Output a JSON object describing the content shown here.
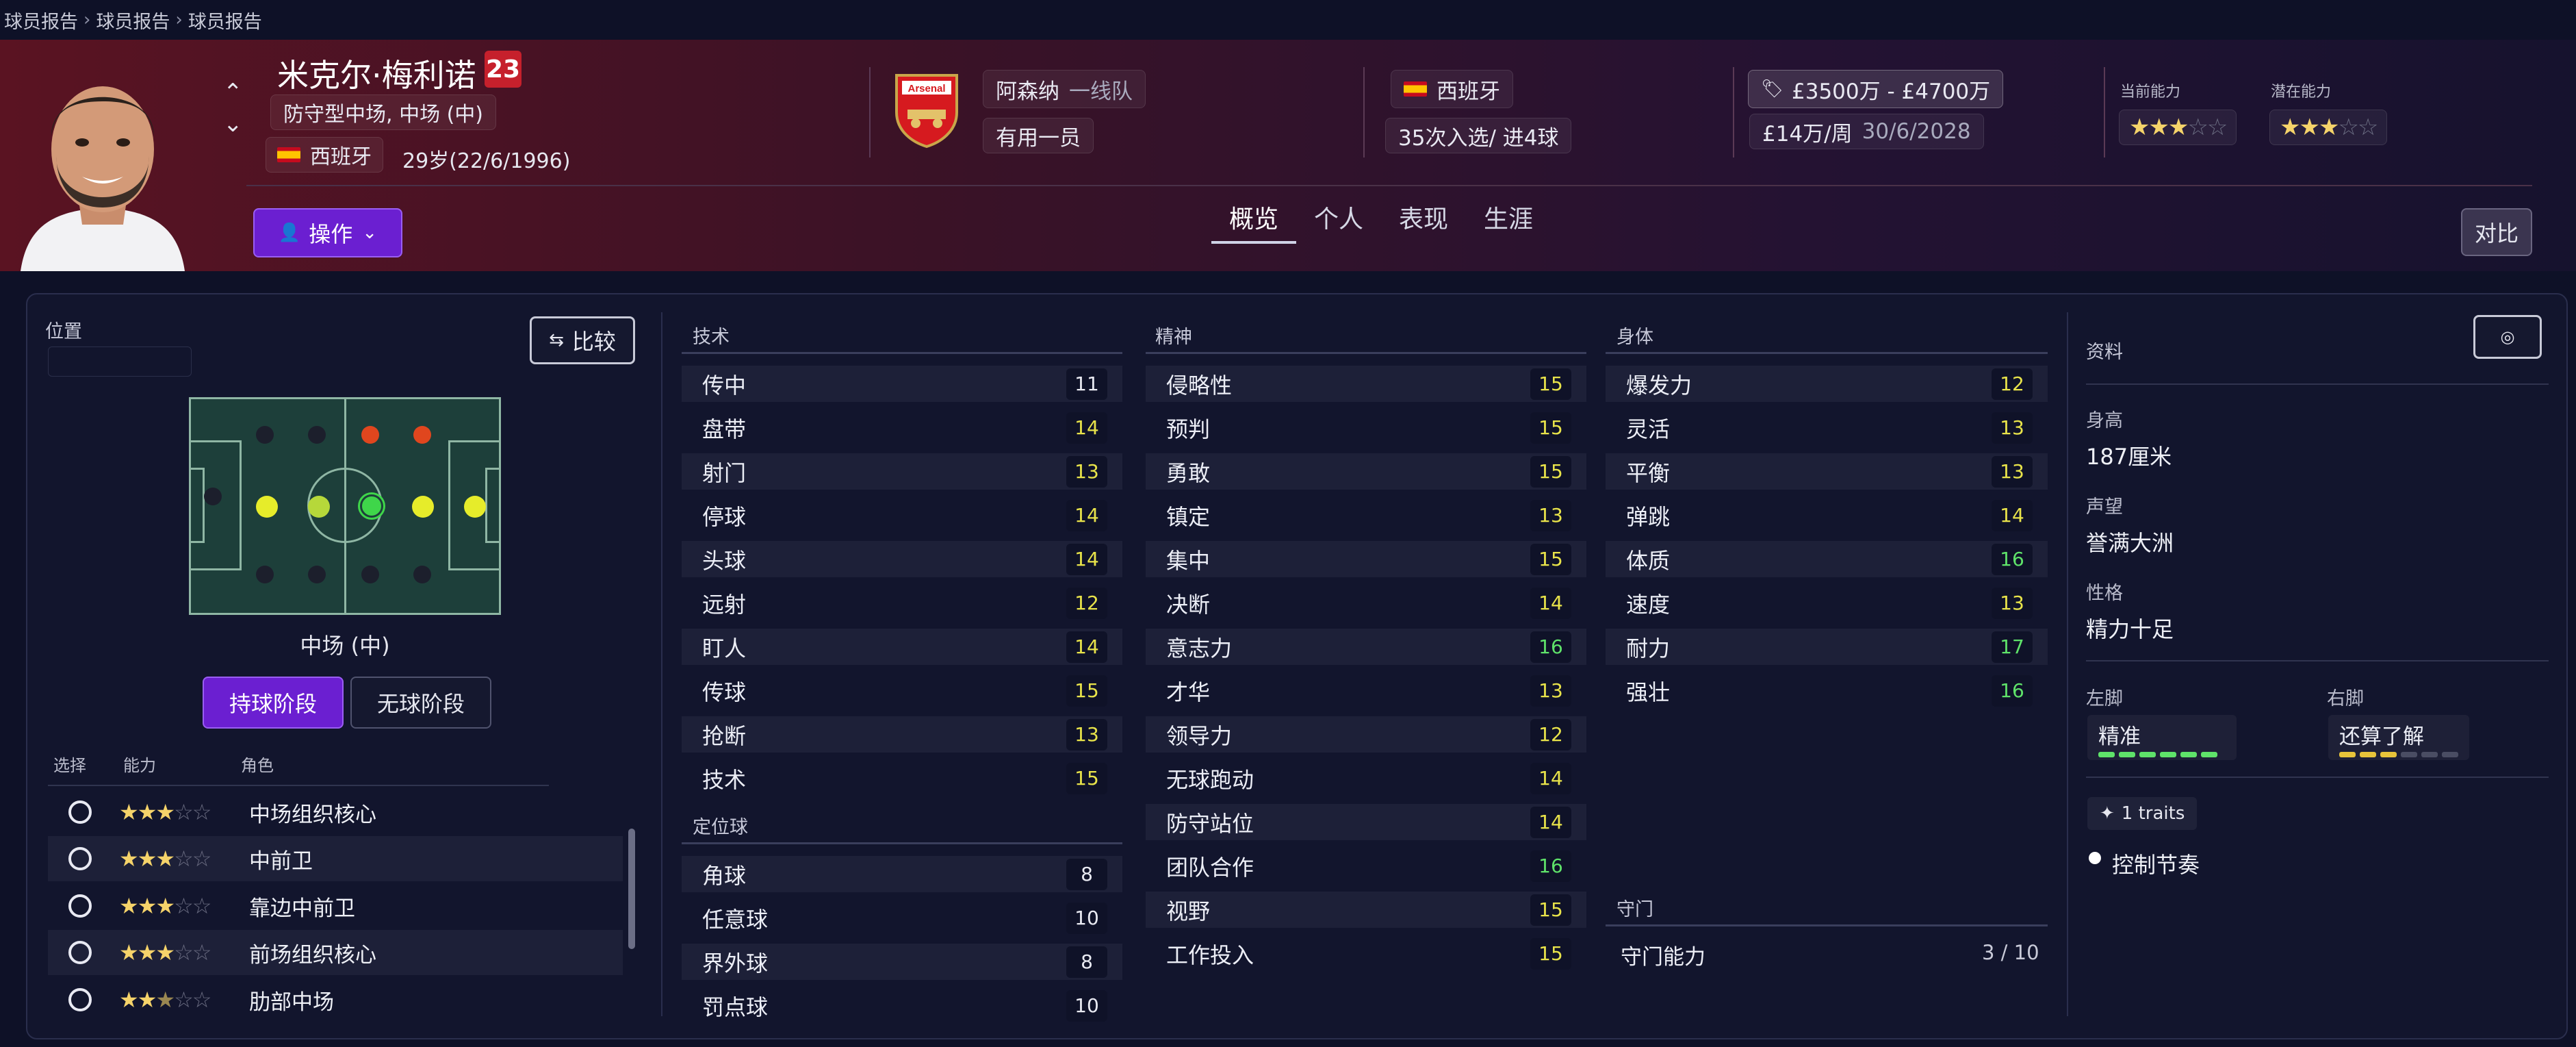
{
  "breadcrumb": [
    "球员报告",
    "球员报告",
    "球员报告"
  ],
  "player": {
    "name": "米克尔·梅利诺",
    "number": "23",
    "positions": "防守型中场, 中场 (中)",
    "nation": "西班牙",
    "age_dob": "29岁(22/6/1996)",
    "action_label": "操作"
  },
  "club": {
    "name": "阿森纳",
    "squad": "一线队",
    "crest_text": "Arsenal",
    "status": "有用一员"
  },
  "international": {
    "nation": "西班牙",
    "caps": "35次入选/ 进4球"
  },
  "contract": {
    "value": "£3500万 - £4700万",
    "wage": "£14万/周",
    "expires": "30/6/2028"
  },
  "ability": {
    "current_label": "当前能力",
    "current_stars": 3,
    "potential_label": "潜在能力",
    "potential_stars": 3
  },
  "tabs": [
    "概览",
    "个人",
    "表现",
    "生涯"
  ],
  "active_tab": 0,
  "compare_label": "对比",
  "position_panel": {
    "title": "位置",
    "compare_btn": "比较",
    "position_name": "中场 (中)",
    "phase_in": "持球阶段",
    "phase_out": "无球阶段",
    "col_select": "选择",
    "col_ability": "能力",
    "col_role": "角色",
    "roles": [
      {
        "name": "中场组织核心",
        "stars": 3
      },
      {
        "name": "中前卫",
        "stars": 3
      },
      {
        "name": "靠边中前卫",
        "stars": 3
      },
      {
        "name": "前场组织核心",
        "stars": 3
      },
      {
        "name": "肋部中场",
        "stars": 2.5
      }
    ]
  },
  "attributes": {
    "technical_title": "技术",
    "technical": [
      {
        "name": "传中",
        "value": 11
      },
      {
        "name": "盘带",
        "value": 14
      },
      {
        "name": "射门",
        "value": 13
      },
      {
        "name": "停球",
        "value": 14
      },
      {
        "name": "头球",
        "value": 14
      },
      {
        "name": "远射",
        "value": 12
      },
      {
        "name": "盯人",
        "value": 14
      },
      {
        "name": "传球",
        "value": 15
      },
      {
        "name": "抢断",
        "value": 13
      },
      {
        "name": "技术",
        "value": 15
      }
    ],
    "setpieces_title": "定位球",
    "setpieces": [
      {
        "name": "角球",
        "value": 8
      },
      {
        "name": "任意球",
        "value": 10
      },
      {
        "name": "界外球",
        "value": 8
      },
      {
        "name": "罚点球",
        "value": 10
      }
    ],
    "mental_title": "精神",
    "mental": [
      {
        "name": "侵略性",
        "value": 15
      },
      {
        "name": "预判",
        "value": 15
      },
      {
        "name": "勇敢",
        "value": 15
      },
      {
        "name": "镇定",
        "value": 13
      },
      {
        "name": "集中",
        "value": 15
      },
      {
        "name": "决断",
        "value": 14
      },
      {
        "name": "意志力",
        "value": 16
      },
      {
        "name": "才华",
        "value": 13
      },
      {
        "name": "领导力",
        "value": 12
      },
      {
        "name": "无球跑动",
        "value": 14
      },
      {
        "name": "防守站位",
        "value": 14
      },
      {
        "name": "团队合作",
        "value": 16
      },
      {
        "name": "视野",
        "value": 15
      },
      {
        "name": "工作投入",
        "value": 15
      }
    ],
    "physical_title": "身体",
    "physical": [
      {
        "name": "爆发力",
        "value": 12
      },
      {
        "name": "灵活",
        "value": 13
      },
      {
        "name": "平衡",
        "value": 13
      },
      {
        "name": "弹跳",
        "value": 14
      },
      {
        "name": "体质",
        "value": 16
      },
      {
        "name": "速度",
        "value": 13
      },
      {
        "name": "耐力",
        "value": 17
      },
      {
        "name": "强壮",
        "value": 16
      }
    ],
    "goalkeeping_title": "守门",
    "goalkeeping_label": "守门能力",
    "goalkeeping_value": "3 / 10"
  },
  "profile": {
    "title": "资料",
    "height_label": "身高",
    "height": "187厘米",
    "reputation_label": "声望",
    "reputation": "誉满大洲",
    "personality_label": "性格",
    "personality": "精力十足",
    "left_foot_label": "左脚",
    "left_foot": "精准",
    "left_foot_level": 6,
    "right_foot_label": "右脚",
    "right_foot": "还算了解",
    "right_foot_level": 3,
    "traits_label": "1 traits",
    "traits": [
      "控制节奏"
    ]
  },
  "colors": {
    "accent": "#6b1fd1",
    "value_white": "#e9eaf2",
    "value_yellow": "#e8e34a",
    "value_green": "#5fe36a"
  }
}
